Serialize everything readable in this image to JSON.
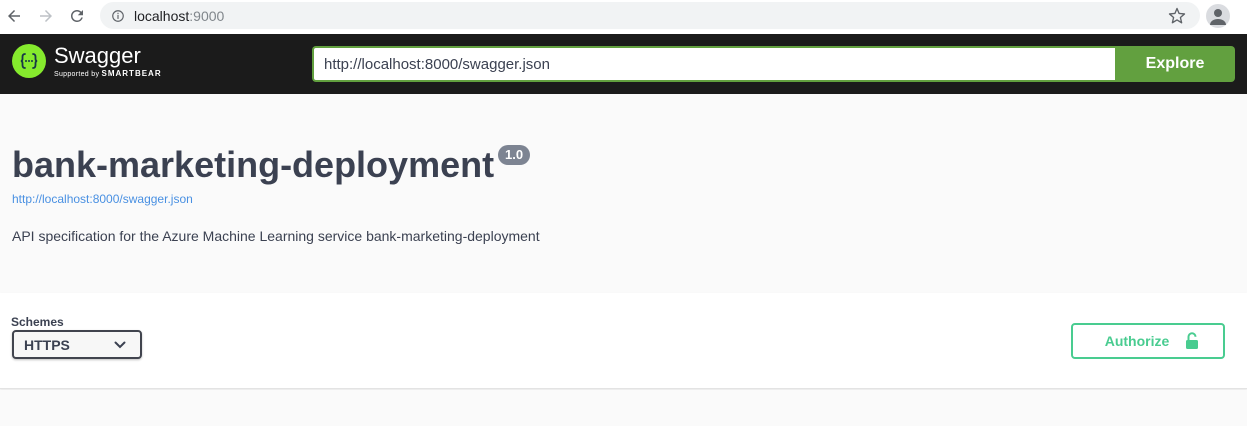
{
  "browser": {
    "url_host": "localhost",
    "url_port": ":9000",
    "icons": [
      "back-icon",
      "forward-icon",
      "reload-icon",
      "info-icon",
      "star-icon",
      "profile-icon"
    ]
  },
  "topbar": {
    "logo_title": "Swagger",
    "logo_sub_prefix": "Supported by ",
    "logo_sub_brand": "SMARTBEAR",
    "spec_url_value": "http://localhost:8000/swagger.json",
    "explore_label": "Explore",
    "accent_color": "#62a03f",
    "logo_color": "#85ea2d"
  },
  "info": {
    "title": "bank-marketing-deployment",
    "version": "1.0",
    "spec_link": "http://localhost:8000/swagger.json",
    "description": "API specification for the Azure Machine Learning service bank-marketing-deployment"
  },
  "schemes": {
    "label": "Schemes",
    "selected": "HTTPS"
  },
  "authorize": {
    "label": "Authorize",
    "color": "#49cc90"
  }
}
